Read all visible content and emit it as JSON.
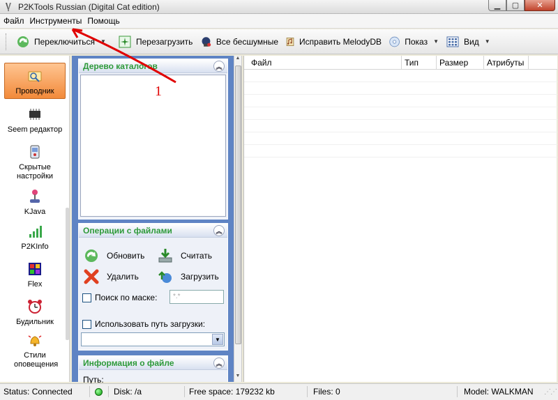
{
  "window": {
    "title": "P2KTools Russian (Digital Cat edition)",
    "controls": [
      "minimize",
      "maximize",
      "close"
    ]
  },
  "menu": [
    "Файл",
    "Инструменты",
    "Помощь"
  ],
  "toolbar": {
    "items": [
      {
        "label": "Переключиться",
        "icon": "switch-icon",
        "dropdown": true
      },
      {
        "label": "Перезагрузить",
        "icon": "reboot-icon",
        "dropdown": false
      },
      {
        "label": "Все бесшумные",
        "icon": "silent-icon",
        "dropdown": false
      },
      {
        "label": "Исправить MelodyDB",
        "icon": "melody-icon",
        "dropdown": false
      },
      {
        "label": "Показ",
        "icon": "cd-icon",
        "dropdown": true
      },
      {
        "label": "Вид",
        "icon": "view-grid-icon",
        "dropdown": true
      }
    ]
  },
  "sidebar": {
    "items": [
      {
        "label": "Проводник",
        "icon": "explorer-icon",
        "active": true
      },
      {
        "label": "Seem редактор",
        "icon": "chip-icon",
        "active": false
      },
      {
        "label": "Скрытые настройки",
        "icon": "hidden-settings-icon",
        "active": false
      },
      {
        "label": "KJava",
        "icon": "joystick-icon",
        "active": false
      },
      {
        "label": "P2KInfo",
        "icon": "signal-icon",
        "active": false
      },
      {
        "label": "Flex",
        "icon": "flex-icon",
        "active": false
      },
      {
        "label": "Будильник",
        "icon": "alarm-clock-icon",
        "active": false
      },
      {
        "label": "Стили оповещения",
        "icon": "bell-icon",
        "active": false
      }
    ]
  },
  "panels": {
    "tree": {
      "title": "Дерево каталогов"
    },
    "operations": {
      "title": "Операции с файлами",
      "refresh": "Обновить",
      "read": "Считать",
      "delete": "Удалить",
      "upload": "Загрузить",
      "mask_label": "Поиск по маске:",
      "mask_value": "*.*",
      "use_path_label": "Использовать путь загрузки:"
    },
    "info": {
      "title": "Информация о файле",
      "path_label": "Путь:"
    }
  },
  "filelist": {
    "columns": [
      "Файл",
      "Тип",
      "Размер",
      "Атрибуты"
    ]
  },
  "status": {
    "status": "Status: Connected",
    "disk": "Disk: /a",
    "free": "Free space: 179232 kb",
    "files": "Files: 0",
    "model": "Model: WALKMAN",
    "led_color": "#11b311"
  },
  "annotation": {
    "label": "1",
    "color": "#e00000"
  }
}
